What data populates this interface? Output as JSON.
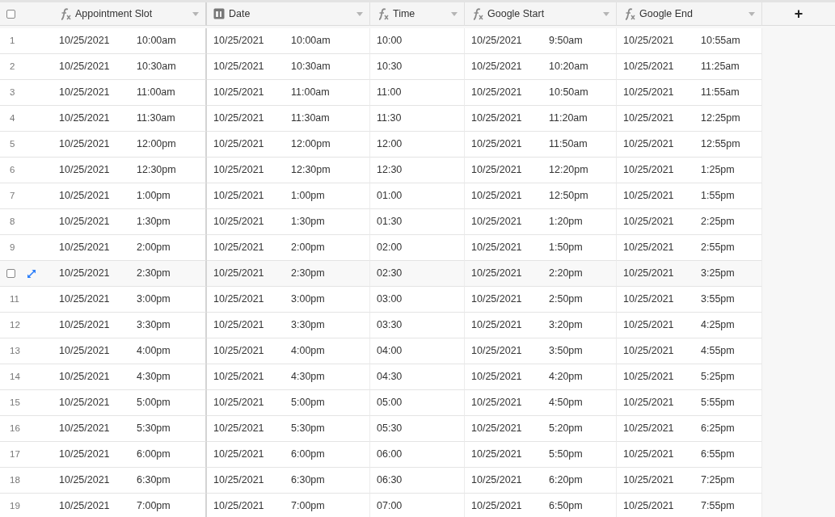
{
  "header": {
    "select_all": {
      "checked": false
    },
    "columns": [
      {
        "label": "Appointment Slot",
        "kind": "formula"
      },
      {
        "label": "Date",
        "kind": "date"
      },
      {
        "label": "Time",
        "kind": "formula"
      },
      {
        "label": "Google Start",
        "kind": "formula"
      },
      {
        "label": "Google End",
        "kind": "formula"
      }
    ],
    "add_column": "+"
  },
  "rows": [
    {
      "number": "1",
      "hovered": false,
      "cells": [
        [
          "10/25/2021",
          "10:00am"
        ],
        [
          "10/25/2021",
          "10:00am"
        ],
        [
          "10:00"
        ],
        [
          "10/25/2021",
          "9:50am"
        ],
        [
          "10/25/2021",
          "10:55am"
        ]
      ]
    },
    {
      "number": "2",
      "hovered": false,
      "cells": [
        [
          "10/25/2021",
          "10:30am"
        ],
        [
          "10/25/2021",
          "10:30am"
        ],
        [
          "10:30"
        ],
        [
          "10/25/2021",
          "10:20am"
        ],
        [
          "10/25/2021",
          "11:25am"
        ]
      ]
    },
    {
      "number": "3",
      "hovered": false,
      "cells": [
        [
          "10/25/2021",
          "11:00am"
        ],
        [
          "10/25/2021",
          "11:00am"
        ],
        [
          "11:00"
        ],
        [
          "10/25/2021",
          "10:50am"
        ],
        [
          "10/25/2021",
          "11:55am"
        ]
      ]
    },
    {
      "number": "4",
      "hovered": false,
      "cells": [
        [
          "10/25/2021",
          "11:30am"
        ],
        [
          "10/25/2021",
          "11:30am"
        ],
        [
          "11:30"
        ],
        [
          "10/25/2021",
          "11:20am"
        ],
        [
          "10/25/2021",
          "12:25pm"
        ]
      ]
    },
    {
      "number": "5",
      "hovered": false,
      "cells": [
        [
          "10/25/2021",
          "12:00pm"
        ],
        [
          "10/25/2021",
          "12:00pm"
        ],
        [
          "12:00"
        ],
        [
          "10/25/2021",
          "11:50am"
        ],
        [
          "10/25/2021",
          "12:55pm"
        ]
      ]
    },
    {
      "number": "6",
      "hovered": false,
      "cells": [
        [
          "10/25/2021",
          "12:30pm"
        ],
        [
          "10/25/2021",
          "12:30pm"
        ],
        [
          "12:30"
        ],
        [
          "10/25/2021",
          "12:20pm"
        ],
        [
          "10/25/2021",
          "1:25pm"
        ]
      ]
    },
    {
      "number": "7",
      "hovered": false,
      "cells": [
        [
          "10/25/2021",
          "1:00pm"
        ],
        [
          "10/25/2021",
          "1:00pm"
        ],
        [
          "01:00"
        ],
        [
          "10/25/2021",
          "12:50pm"
        ],
        [
          "10/25/2021",
          "1:55pm"
        ]
      ]
    },
    {
      "number": "8",
      "hovered": false,
      "cells": [
        [
          "10/25/2021",
          "1:30pm"
        ],
        [
          "10/25/2021",
          "1:30pm"
        ],
        [
          "01:30"
        ],
        [
          "10/25/2021",
          "1:20pm"
        ],
        [
          "10/25/2021",
          "2:25pm"
        ]
      ]
    },
    {
      "number": "9",
      "hovered": false,
      "cells": [
        [
          "10/25/2021",
          "2:00pm"
        ],
        [
          "10/25/2021",
          "2:00pm"
        ],
        [
          "02:00"
        ],
        [
          "10/25/2021",
          "1:50pm"
        ],
        [
          "10/25/2021",
          "2:55pm"
        ]
      ]
    },
    {
      "hovered": true,
      "checked": false,
      "cells": [
        [
          "10/25/2021",
          "2:30pm"
        ],
        [
          "10/25/2021",
          "2:30pm"
        ],
        [
          "02:30"
        ],
        [
          "10/25/2021",
          "2:20pm"
        ],
        [
          "10/25/2021",
          "3:25pm"
        ]
      ]
    },
    {
      "number": "11",
      "hovered": false,
      "cells": [
        [
          "10/25/2021",
          "3:00pm"
        ],
        [
          "10/25/2021",
          "3:00pm"
        ],
        [
          "03:00"
        ],
        [
          "10/25/2021",
          "2:50pm"
        ],
        [
          "10/25/2021",
          "3:55pm"
        ]
      ]
    },
    {
      "number": "12",
      "hovered": false,
      "cells": [
        [
          "10/25/2021",
          "3:30pm"
        ],
        [
          "10/25/2021",
          "3:30pm"
        ],
        [
          "03:30"
        ],
        [
          "10/25/2021",
          "3:20pm"
        ],
        [
          "10/25/2021",
          "4:25pm"
        ]
      ]
    },
    {
      "number": "13",
      "hovered": false,
      "cells": [
        [
          "10/25/2021",
          "4:00pm"
        ],
        [
          "10/25/2021",
          "4:00pm"
        ],
        [
          "04:00"
        ],
        [
          "10/25/2021",
          "3:50pm"
        ],
        [
          "10/25/2021",
          "4:55pm"
        ]
      ]
    },
    {
      "number": "14",
      "hovered": false,
      "cells": [
        [
          "10/25/2021",
          "4:30pm"
        ],
        [
          "10/25/2021",
          "4:30pm"
        ],
        [
          "04:30"
        ],
        [
          "10/25/2021",
          "4:20pm"
        ],
        [
          "10/25/2021",
          "5:25pm"
        ]
      ]
    },
    {
      "number": "15",
      "hovered": false,
      "cells": [
        [
          "10/25/2021",
          "5:00pm"
        ],
        [
          "10/25/2021",
          "5:00pm"
        ],
        [
          "05:00"
        ],
        [
          "10/25/2021",
          "4:50pm"
        ],
        [
          "10/25/2021",
          "5:55pm"
        ]
      ]
    },
    {
      "number": "16",
      "hovered": false,
      "cells": [
        [
          "10/25/2021",
          "5:30pm"
        ],
        [
          "10/25/2021",
          "5:30pm"
        ],
        [
          "05:30"
        ],
        [
          "10/25/2021",
          "5:20pm"
        ],
        [
          "10/25/2021",
          "6:25pm"
        ]
      ]
    },
    {
      "number": "17",
      "hovered": false,
      "cells": [
        [
          "10/25/2021",
          "6:00pm"
        ],
        [
          "10/25/2021",
          "6:00pm"
        ],
        [
          "06:00"
        ],
        [
          "10/25/2021",
          "5:50pm"
        ],
        [
          "10/25/2021",
          "6:55pm"
        ]
      ]
    },
    {
      "number": "18",
      "hovered": false,
      "cells": [
        [
          "10/25/2021",
          "6:30pm"
        ],
        [
          "10/25/2021",
          "6:30pm"
        ],
        [
          "06:30"
        ],
        [
          "10/25/2021",
          "6:20pm"
        ],
        [
          "10/25/2021",
          "7:25pm"
        ]
      ]
    },
    {
      "number": "19",
      "hovered": false,
      "cells": [
        [
          "10/25/2021",
          "7:00pm"
        ],
        [
          "10/25/2021",
          "7:00pm"
        ],
        [
          "07:00"
        ],
        [
          "10/25/2021",
          "6:50pm"
        ],
        [
          "10/25/2021",
          "7:55pm"
        ]
      ]
    }
  ]
}
